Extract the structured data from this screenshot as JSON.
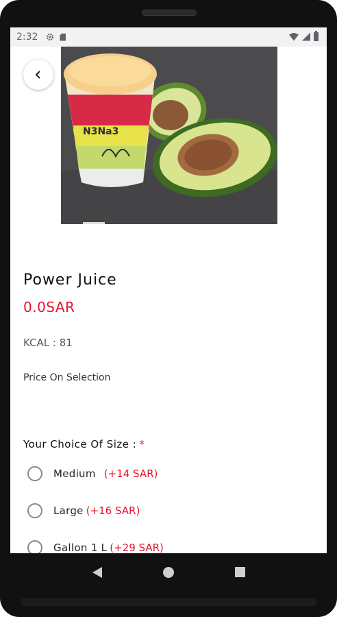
{
  "status_bar": {
    "time": "2:32",
    "icons": [
      "gear-icon",
      "sdcard-icon",
      "wifi-icon",
      "signal-icon",
      "battery-icon"
    ]
  },
  "product": {
    "image_icon": "product-photo",
    "image_text": "N3Na3",
    "name": "Power Juice",
    "price": "0.0SAR",
    "kcal": "KCAL : 81",
    "price_note": "Price On Selection"
  },
  "size_choice": {
    "heading": "Your Choice Of Size :",
    "required_marker": "*",
    "options": [
      {
        "label": "Medium",
        "extra": "(+14 SAR)"
      },
      {
        "label": "Large",
        "extra": "(+16 SAR)"
      },
      {
        "label": "Gallon 1 L",
        "extra": "(+29 SAR)"
      }
    ]
  },
  "colors": {
    "accent": "#e4152f",
    "text": "#111111",
    "muted": "#555555"
  },
  "nav": {
    "back_icon": "back-triangle-icon",
    "home_icon": "home-circle-icon",
    "recent_icon": "recent-square-icon"
  }
}
